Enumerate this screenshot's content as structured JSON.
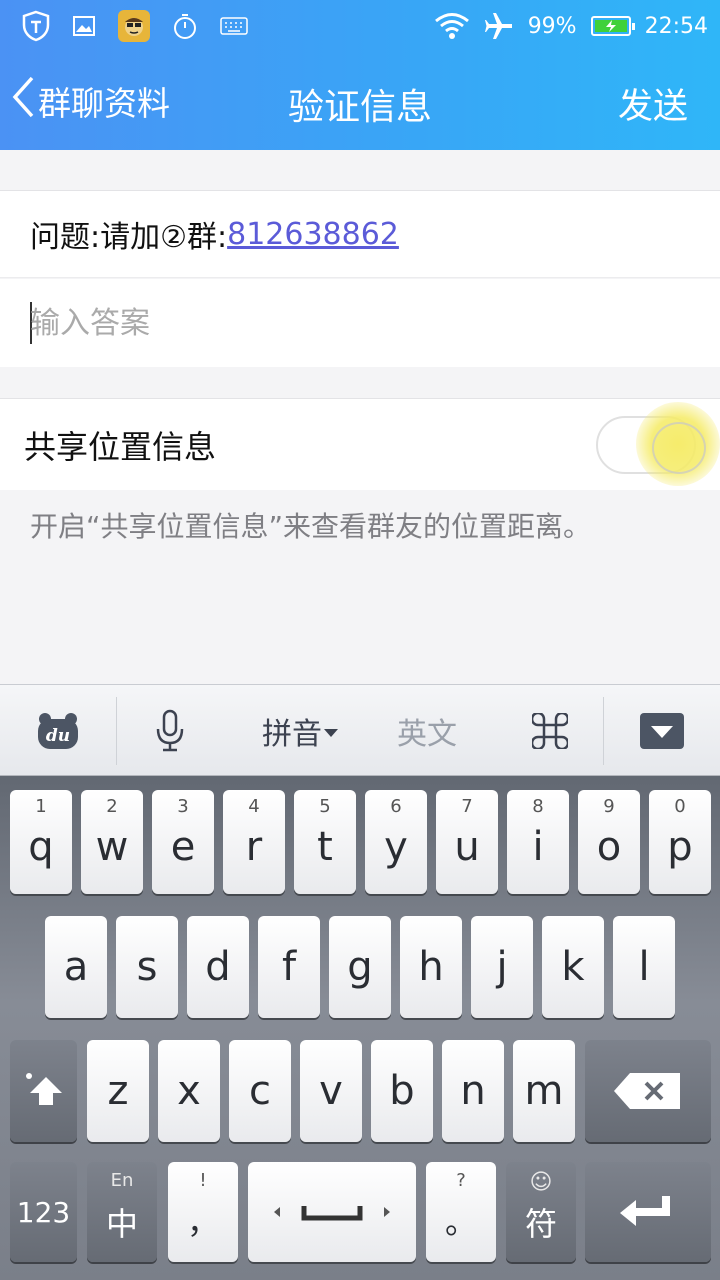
{
  "status_bar": {
    "battery": "99%",
    "time": "22:54"
  },
  "header": {
    "back_label": "群聊资料",
    "title": "验证信息",
    "send_label": "发送"
  },
  "question": {
    "prefix": "问题:请加②群:",
    "link": "812638862"
  },
  "answer": {
    "placeholder": "输入答案",
    "value": ""
  },
  "share_location": {
    "label": "共享位置信息",
    "enabled": false,
    "hint": "开启“共享位置信息”来查看群友的位置距离。"
  },
  "keyboard": {
    "toolbar": {
      "logo": "du",
      "pinyin": "拼音",
      "english": "英文"
    },
    "row1": [
      {
        "num": "1",
        "ch": "q"
      },
      {
        "num": "2",
        "ch": "w"
      },
      {
        "num": "3",
        "ch": "e"
      },
      {
        "num": "4",
        "ch": "r"
      },
      {
        "num": "5",
        "ch": "t"
      },
      {
        "num": "6",
        "ch": "y"
      },
      {
        "num": "7",
        "ch": "u"
      },
      {
        "num": "8",
        "ch": "i"
      },
      {
        "num": "9",
        "ch": "o"
      },
      {
        "num": "0",
        "ch": "p"
      }
    ],
    "row2": [
      "a",
      "s",
      "d",
      "f",
      "g",
      "h",
      "j",
      "k",
      "l"
    ],
    "row3": [
      "z",
      "x",
      "c",
      "v",
      "b",
      "n",
      "m"
    ],
    "bottom": {
      "numbers": "123",
      "lang_top": "En",
      "lang_main": "中",
      "comma_top": "!",
      "comma_main": "，",
      "period_top": "?",
      "period_main": "。",
      "symbol_top": "☺",
      "symbol_main": "符"
    }
  }
}
